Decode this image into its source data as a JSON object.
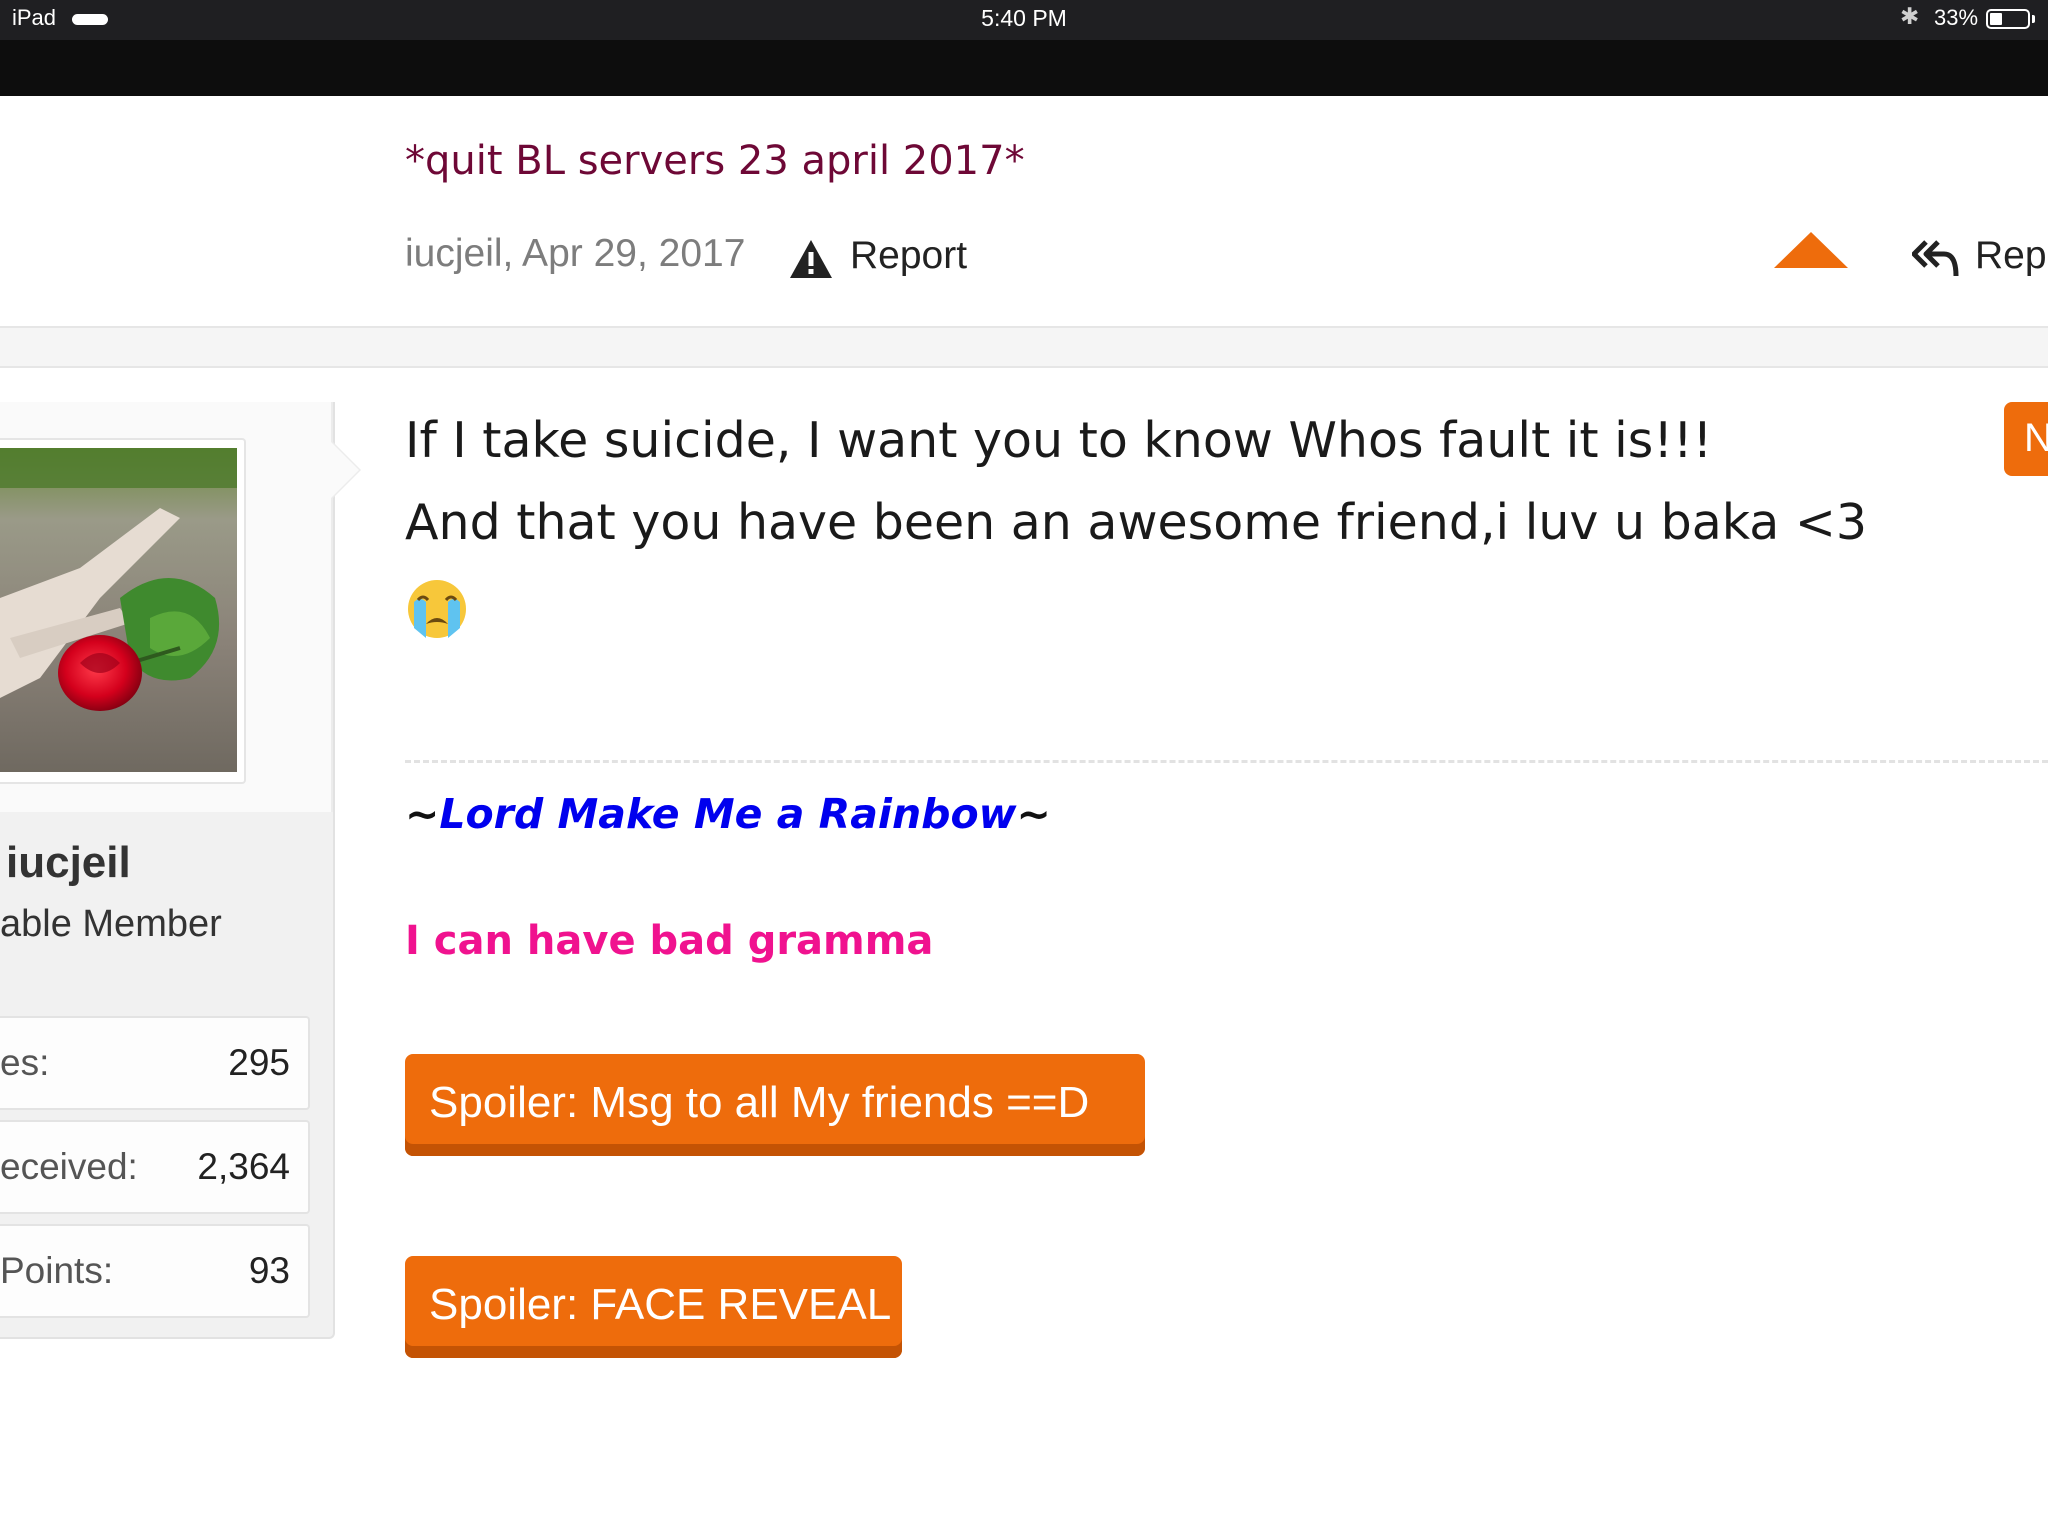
{
  "status_bar": {
    "device": "iPad",
    "time": "5:40 PM",
    "battery": "33%"
  },
  "prev_post": {
    "signature": "*quit BL servers 23 april 2017*",
    "meta": "iucjeil, Apr 29, 2017",
    "report_label": "Report",
    "reply_label": "Rep"
  },
  "user": {
    "name": "iucjeil",
    "title": "able Member",
    "stats": [
      {
        "label": "es:",
        "value": "295"
      },
      {
        "label": "eceived:",
        "value": "2,364"
      },
      {
        "label": "Points:",
        "value": "93"
      }
    ]
  },
  "message": {
    "line1": "If I take suicide, I want you to know Whos fault it is!!!",
    "line2": "And that you have been an awesome friend,i luv u baka <3",
    "new_badge": "N"
  },
  "signature": {
    "tilde": "~",
    "rainbow": "Lord Make Me a Rainbow",
    "gramma": "I can have bad gramma",
    "spoilers": [
      "Spoiler: Msg to all My friends ==D",
      "Spoiler: FACE REVEAL"
    ]
  },
  "colors": {
    "accent": "#ee6c0c",
    "sig_purple": "#6e0836",
    "rainbow_blue": "#0000ee",
    "pink": "#f0128f"
  },
  "icons": {
    "report": "warning-icon",
    "reply": "reply-all-icon",
    "like": "up-arrow-icon",
    "emoji": "crying-face-emoji"
  }
}
